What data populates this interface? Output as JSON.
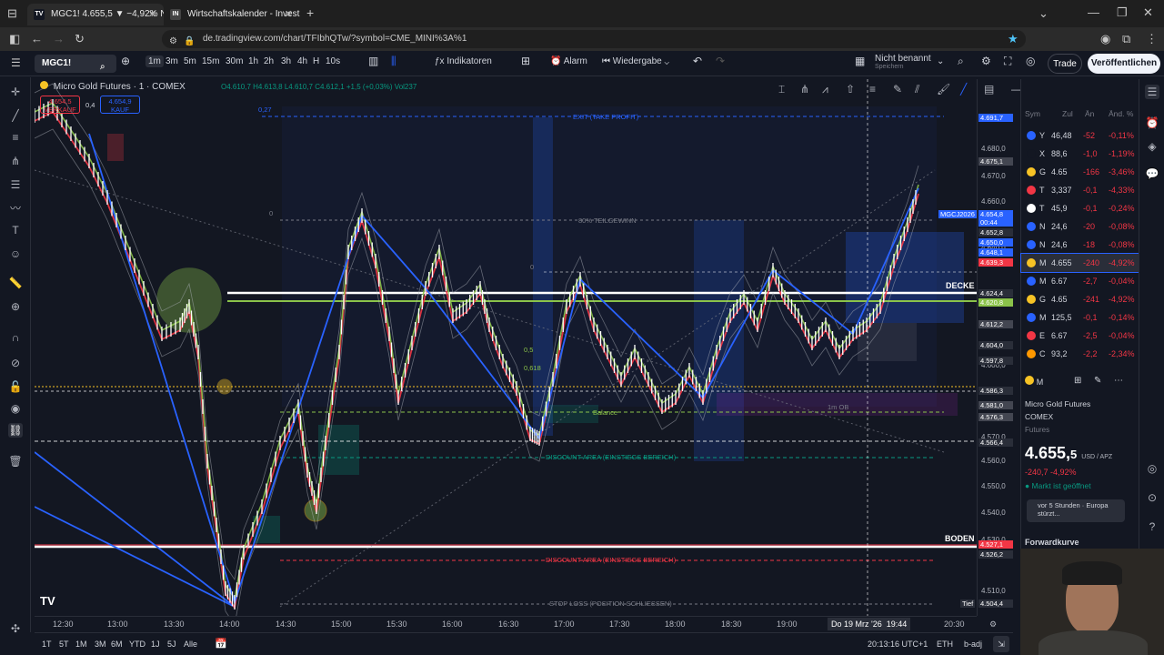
{
  "browser": {
    "tabs": [
      {
        "label": "MGC1! 4.655,5 ▼ −4,92% Nicht",
        "favicon": "TV",
        "active": true
      },
      {
        "label": "Wirtschaftskalender - Investing",
        "favicon": "IN",
        "active": false
      }
    ],
    "url": "de.tradingview.com/chart/TFIbhQTw/?symbol=CME_MINI%3A%1",
    "new_tab": "+"
  },
  "header": {
    "symbol": "MGC1!",
    "intervals": [
      "1m",
      "3m",
      "5m",
      "15m",
      "30m",
      "1h",
      "2h",
      "3h",
      "4h",
      "H",
      "10s"
    ],
    "indicators": "Indikatoren",
    "alarm": "Alarm",
    "replay": "Wiedergabe",
    "layout_name": "Nicht benannt",
    "layout_status": "Speichern",
    "trade": "Trade",
    "publish": "Veröffentlichen"
  },
  "legend": {
    "title": "Micro Gold Futures · 1 · COMEX",
    "ohlc": "O4.610,7  H4.613,8  L4.610,7  C4.612,1  +1,5 (+0,03%)  Vol237",
    "sell_price": "4.654,5",
    "sell_label": "VERKAUF",
    "spread": "0,4",
    "buy_price": "4.654,9",
    "buy_label": "KAUF"
  },
  "annotations": {
    "exit": "EXIT (TAKE PROFIT)",
    "take": "80% TEILGEWINN",
    "decke": "DECKE",
    "boden": "BODEN",
    "balance": "Balance",
    "ob": "1m OB",
    "discount1": "DISCOUNT AREA (EINSTIEGS BEREICH)",
    "discount2": "DISCOUNT AREA (EINSTIEGS BEREICH)",
    "stoploss": "STOP LOSS (POSITION SCHLIESSEN)",
    "tief": "Tief",
    "fib_027": "0,27",
    "fib_0": "0",
    "fib_05": "0,5",
    "fib_0618": "0,618",
    "symbol_flag": "MGCJ2026"
  },
  "price_axis": {
    "ticks": [
      "4.680,0",
      "4.670,0",
      "4.660,0",
      "4.640,0",
      "4.600,0",
      "4.570,0",
      "4.560,0",
      "4.550,0",
      "4.540,0",
      "4.530,0",
      "4.510,0"
    ],
    "tags": [
      {
        "text": "4.691,7",
        "color": "#2962ff"
      },
      {
        "text": "4.675,1",
        "color": "#434651"
      },
      {
        "text": "4.654,8",
        "color": "#2962ff"
      },
      {
        "text": "00:44",
        "color": "#2962ff"
      },
      {
        "text": "4.652,8",
        "color": "#2a2e39"
      },
      {
        "text": "4.650,0",
        "color": "#2962ff"
      },
      {
        "text": "4.648,1",
        "color": "#2962ff"
      },
      {
        "text": "4.639,3",
        "color": "#f23645"
      },
      {
        "text": "4.624,4",
        "color": "#2a2e39"
      },
      {
        "text": "4.620,8",
        "color": "#8bc34a"
      },
      {
        "text": "4.612,2",
        "color": "#434651"
      },
      {
        "text": "4.604,0",
        "color": "#2a2e39"
      },
      {
        "text": "4.597,8",
        "color": "#2a2e39"
      },
      {
        "text": "4.586,3",
        "color": "#2a2e39"
      },
      {
        "text": "4.581,0",
        "color": "#434651"
      },
      {
        "text": "4.576,3",
        "color": "#434651"
      },
      {
        "text": "4.566,4",
        "color": "#2a2e39"
      },
      {
        "text": "4.527,1",
        "color": "#f23645"
      },
      {
        "text": "4.526,2",
        "color": "#2a2e39"
      },
      {
        "text": "4.504,4",
        "color": "#2a2e39"
      }
    ]
  },
  "time_axis": {
    "labels": [
      "12:30",
      "13:00",
      "13:30",
      "14:00",
      "14:30",
      "15:00",
      "15:30",
      "16:00",
      "16:30",
      "17:00",
      "17:30",
      "18:00",
      "18:30",
      "19:00",
      "20:30"
    ],
    "crosshair": "Do 19 Mrz '26",
    "crosshair_time": "19:44"
  },
  "bottom": {
    "ranges": [
      "1T",
      "5T",
      "1M",
      "3M",
      "6M",
      "YTD",
      "1J",
      "5J",
      "Alle"
    ],
    "clock": "20:13:16 UTC+1",
    "session": "ETH",
    "adj": "b-adj"
  },
  "watchlist": {
    "header": {
      "sym": "Sym",
      "last": "Zul",
      "chg": "Än",
      "pct": "Änd. %"
    },
    "rows": [
      {
        "sym": "Y",
        "last": "46,48",
        "chg": "-52",
        "pct": "-0,11%",
        "color": "#2962ff"
      },
      {
        "sym": "X",
        "last": "88,6",
        "chg": "-1,0",
        "pct": "-1,19%",
        "color": "#131722"
      },
      {
        "sym": "G",
        "last": "4.65",
        "chg": "-166",
        "pct": "-3,46%",
        "color": "#f7c325"
      },
      {
        "sym": "T",
        "last": "3,337",
        "chg": "-0,1",
        "pct": "-4,33%",
        "color": "#f23645"
      },
      {
        "sym": "T",
        "last": "45,9",
        "chg": "-0,1",
        "pct": "-0,24%",
        "color": "#ffffff"
      },
      {
        "sym": "N",
        "last": "24,6",
        "chg": "-20",
        "pct": "-0,08%",
        "color": "#2962ff"
      },
      {
        "sym": "N",
        "last": "24,6",
        "chg": "-18",
        "pct": "-0,08%",
        "color": "#2962ff"
      },
      {
        "sym": "M",
        "last": "4.655",
        "chg": "-240",
        "pct": "-4,92%",
        "color": "#f7c325"
      },
      {
        "sym": "M",
        "last": "6.67",
        "chg": "-2,7",
        "pct": "-0,04%",
        "color": "#2962ff"
      },
      {
        "sym": "G",
        "last": "4.65",
        "chg": "-241",
        "pct": "-4,92%",
        "color": "#f7c325"
      },
      {
        "sym": "M",
        "last": "125,5",
        "chg": "-0,1",
        "pct": "-0,14%",
        "color": "#2962ff"
      },
      {
        "sym": "E",
        "last": "6.67",
        "chg": "-2,5",
        "pct": "-0,04%",
        "color": "#f23645"
      },
      {
        "sym": "C",
        "last": "93,2",
        "chg": "-2,2",
        "pct": "-2,34%",
        "color": "#ff9800"
      }
    ]
  },
  "detail": {
    "sym": "M",
    "name": "Micro Gold Futures",
    "exchange": "COMEX",
    "type": "Futures",
    "price": "4.655,",
    "price_last": "5",
    "currency": "USD / APZ",
    "change": "-240,7  -4,92%",
    "status": "Markt ist geöffnet",
    "news": "vor 5 Stunden · Europa stürzt...",
    "forward": "Forwardkurve"
  }
}
